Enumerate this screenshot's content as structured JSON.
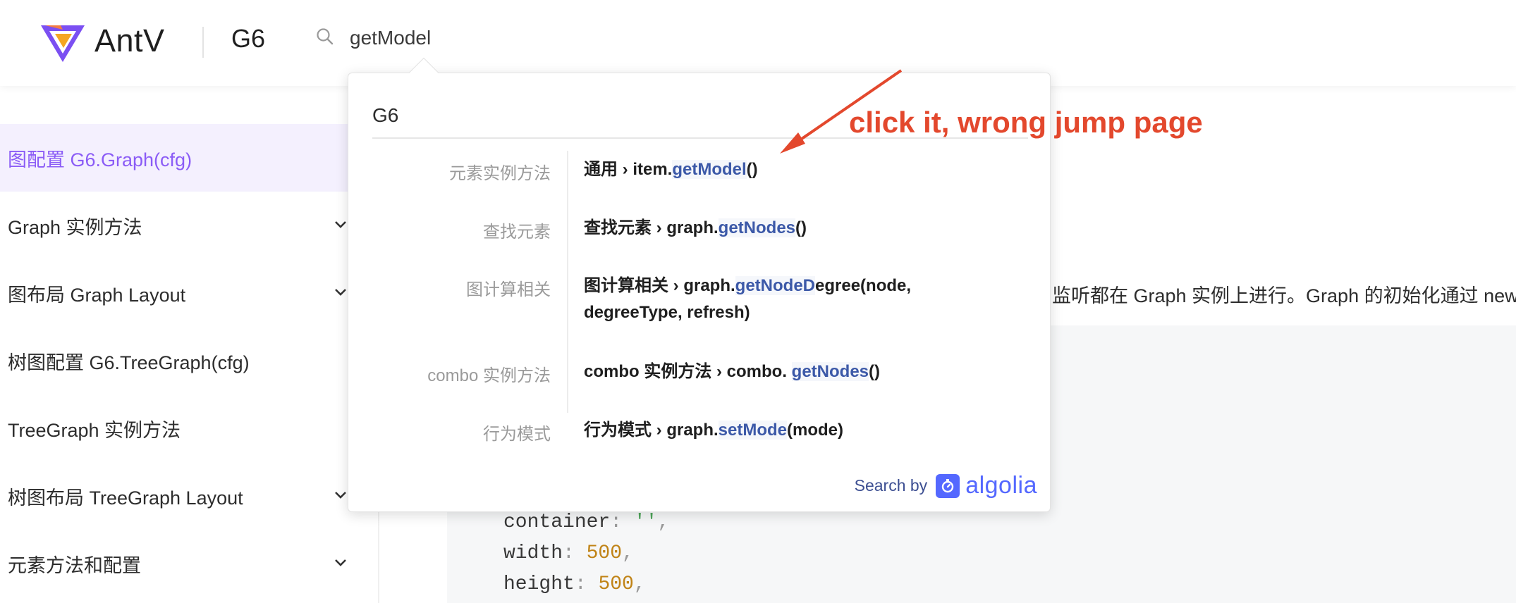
{
  "header": {
    "brand": "AntV",
    "product": "G6",
    "search_value": "getModel"
  },
  "sidebar": {
    "items": [
      {
        "label": "图配置 G6.Graph(cfg)",
        "active": true,
        "expandable": false
      },
      {
        "label": "Graph 实例方法",
        "active": false,
        "expandable": true
      },
      {
        "label": "图布局 Graph Layout",
        "active": false,
        "expandable": true
      },
      {
        "label": "树图配置 G6.TreeGraph(cfg)",
        "active": false,
        "expandable": false
      },
      {
        "label": "TreeGraph 实例方法",
        "active": false,
        "expandable": false
      },
      {
        "label": "树图布局 TreeGraph Layout",
        "active": false,
        "expandable": true
      },
      {
        "label": "元素方法和配置",
        "active": false,
        "expandable": true
      }
    ]
  },
  "content": {
    "text": "监听都在 Graph 实例上进行。Graph 的初始化通过 new",
    "code": {
      "container_key": "container",
      "container_val": "''",
      "width_key": "width",
      "width_val": "500",
      "height_key": "height",
      "height_val": "500"
    }
  },
  "search_dropdown": {
    "group_title": "G6",
    "results": [
      {
        "category": "元素实例方法",
        "prefix": "通用 › item.",
        "highlight": "getModel",
        "suffix": "()",
        "line2": ""
      },
      {
        "category": "查找元素",
        "prefix": "查找元素 › graph.",
        "highlight": "getNodes",
        "suffix": "()",
        "line2": ""
      },
      {
        "category": "图计算相关",
        "prefix": "图计算相关 › graph.",
        "highlight": "getNodeD",
        "suffix": "egree(node,",
        "line2": "degreeType, refresh)"
      },
      {
        "category": "combo 实例方法",
        "prefix": "combo 实例方法 › combo. ",
        "highlight": "getNodes",
        "suffix": "()",
        "line2": ""
      },
      {
        "category": "行为模式",
        "prefix": "行为模式 › graph.",
        "highlight": "setMode",
        "suffix": "(mode)",
        "line2": ""
      }
    ],
    "footer": {
      "search_by": "Search by",
      "algolia": "algolia"
    }
  },
  "annotation": {
    "text": "click it, wrong jump page",
    "color": "#e3482d"
  },
  "colors": {
    "accent": "#8b5cf6",
    "highlight": "#3c59a8",
    "algolia": "#5468ff"
  }
}
